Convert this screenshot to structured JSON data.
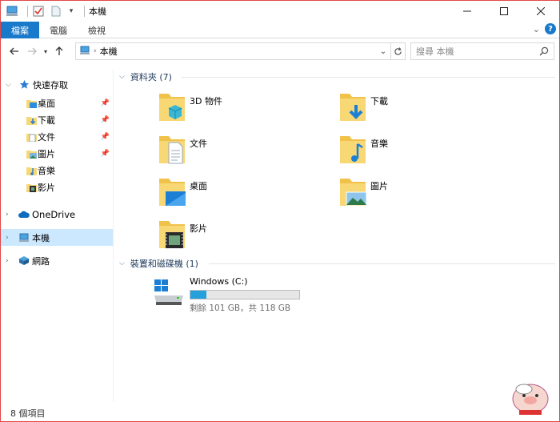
{
  "window": {
    "title": "本機"
  },
  "ribbon": {
    "tabs": [
      "檔案",
      "電腦",
      "檢視"
    ]
  },
  "address": {
    "location": "本機"
  },
  "search": {
    "placeholder": "搜尋 本機"
  },
  "sidebar": {
    "quick_access": "快速存取",
    "quick_items": [
      "桌面",
      "下載",
      "文件",
      "圖片",
      "音樂",
      "影片"
    ],
    "onedrive": "OneDrive",
    "this_pc": "本機",
    "network": "網路"
  },
  "folders_group": {
    "label": "資料夾 (7)"
  },
  "folders": [
    "3D 物件",
    "下載",
    "文件",
    "音樂",
    "桌面",
    "圖片",
    "影片"
  ],
  "devices_group": {
    "label": "裝置和磁碟機 (1)"
  },
  "drive": {
    "name": "Windows (C:)",
    "space": "剩餘 101 GB，共 118 GB",
    "used_fraction": 0.144
  },
  "status": {
    "count": "8 個項目"
  },
  "colors": {
    "accent": "#1979ca",
    "selection": "#cce8ff",
    "folder": "#f8d775"
  }
}
